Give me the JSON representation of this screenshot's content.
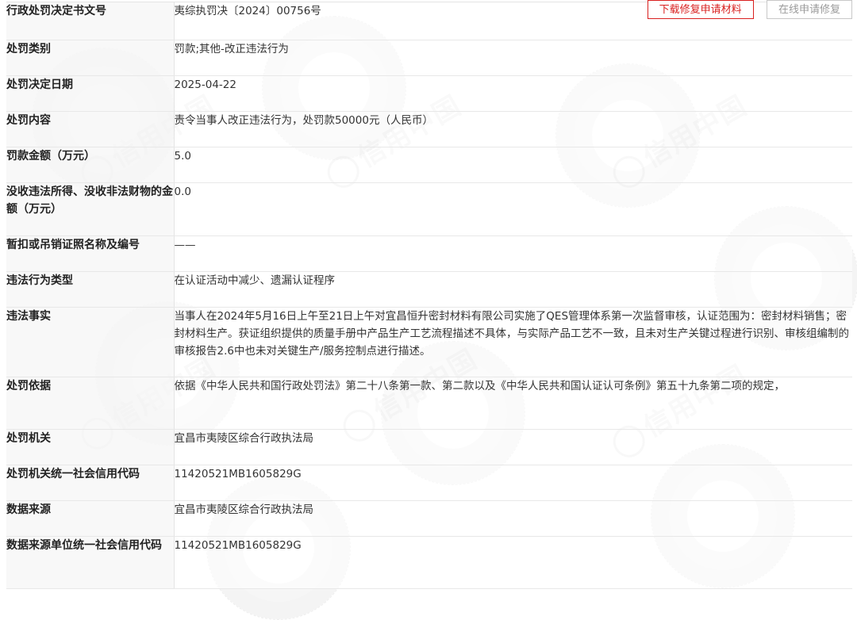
{
  "actions": {
    "download_label": "下载修复申请材料",
    "online_label": "在线申请修复"
  },
  "watermark": "信用中国",
  "colors": {
    "accent": "#d9201f",
    "label_bg": "#f6f6f6",
    "border": "#e4e4e4"
  },
  "rows": [
    {
      "label": "行政处罚决定书文号",
      "value": "夷综执罚决〔2024〕00756号"
    },
    {
      "label": "处罚类别",
      "value": "罚款;其他-改正违法行为"
    },
    {
      "label": "处罚决定日期",
      "value": "2025-04-22"
    },
    {
      "label": "处罚内容",
      "value": "责令当事人改正违法行为，处罚款50000元（人民币）"
    },
    {
      "label": "罚款金额（万元）",
      "value": "5.0"
    },
    {
      "label": "没收违法所得、没收非法财物的金额（万元）",
      "value": "0.0"
    },
    {
      "label": "暂扣或吊销证照名称及编号",
      "value": "——"
    },
    {
      "label": "违法行为类型",
      "value": "在认证活动中减少、遗漏认证程序"
    },
    {
      "label": "违法事实",
      "value": "当事人在2024年5月16日上午至21日上午对宜昌恒升密封材料有限公司实施了QES管理体系第一次监督审核，认证范围为：密封材料销售；密封材料生产。获证组织提供的质量手册中产品生产工艺流程描述不具体，与实际产品工艺不一致，且未对生产关键过程进行识别、审核组编制的审核报告2.6中也未对关键生产/服务控制点进行描述。"
    },
    {
      "label": "处罚依据",
      "value": "依据《中华人民共和国行政处罚法》第二十八条第一款、第二款以及《中华人民共和国认证认可条例》第五十九条第二项的规定，"
    },
    {
      "label": "处罚机关",
      "value": "宜昌市夷陵区综合行政执法局"
    },
    {
      "label": "处罚机关统一社会信用代码",
      "value": "11420521MB1605829G"
    },
    {
      "label": "数据来源",
      "value": "宜昌市夷陵区综合行政执法局"
    },
    {
      "label": "数据来源单位统一社会信用代码",
      "value": "11420521MB1605829G"
    }
  ]
}
